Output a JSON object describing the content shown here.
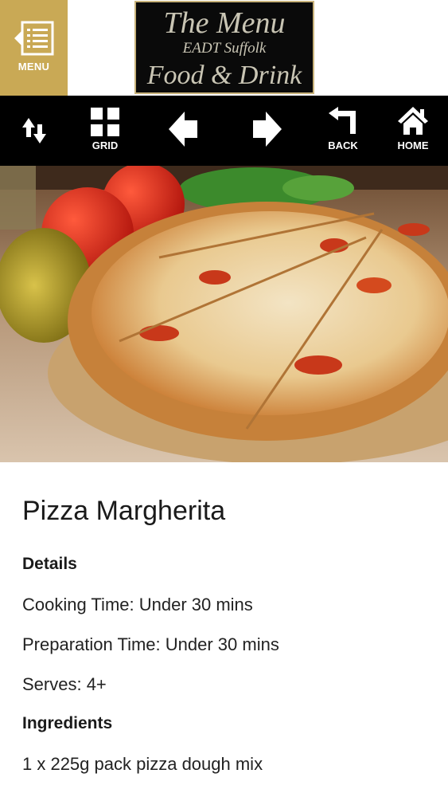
{
  "header": {
    "menu_label": "MENU",
    "logo": {
      "line1": "The Menu",
      "line2": "EADT Suffolk",
      "line3": "Food & Drink"
    }
  },
  "toolbar": {
    "grid_label": "GRID",
    "back_label": "BACK",
    "home_label": "HOME"
  },
  "recipe": {
    "title": "Pizza Margherita",
    "details_heading": "Details",
    "cooking_time": "Cooking Time: Under 30 mins",
    "preparation_time": "Preparation Time: Under 30 mins",
    "serves": "Serves: 4+",
    "ingredients_heading": "Ingredients",
    "ingredients": [
      "1 x 225g pack pizza dough mix"
    ]
  },
  "colors": {
    "accent": "#c9a955",
    "toolbar_bg": "#000000",
    "logo_bg": "#0a0a0a"
  },
  "icons": [
    "list-icon",
    "sort-icon",
    "grid-icon",
    "arrow-left-icon",
    "arrow-right-icon",
    "back-icon",
    "home-icon"
  ]
}
